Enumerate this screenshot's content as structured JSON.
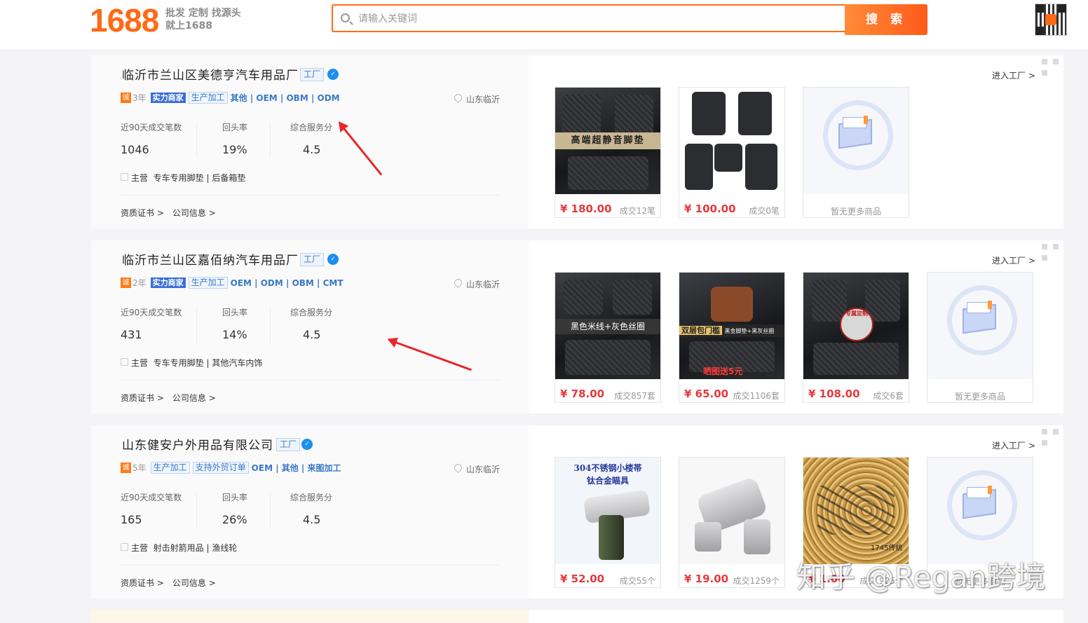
{
  "header": {
    "logo_number": "1688",
    "slogan_line1": "批发 定制 找源头",
    "slogan_line2": "就上1688",
    "search_placeholder": "请输入关键词",
    "search_button": "搜 索"
  },
  "common": {
    "enter_factory": "进入工厂 >",
    "cert_link": "资质证书 >",
    "company_link": "公司信息 >",
    "stat_labels": [
      "近90天成交笔数",
      "回头率",
      "综合服务分"
    ],
    "main_prefix": "主营",
    "factory_tag": "工厂",
    "cheng_icon": "诚",
    "sx_badge": "实力商家",
    "empty_text": "暂无更多商品"
  },
  "cards": [
    {
      "name": "临沂市兰山区美德亨汽车用品厂",
      "years": "3年",
      "tags_boxed": [
        "生产加工"
      ],
      "tags_plain": "其他 | OEM | OBM | ODM",
      "location": "山东临沂",
      "stats": [
        "1046",
        "19%",
        "4.5"
      ],
      "main_business": "专车专用脚垫 | 后备箱垫",
      "products": [
        {
          "price": "¥ 180.00",
          "sales": "成交12笔",
          "banner": "高端超静音脚垫"
        },
        {
          "price": "¥ 100.00",
          "sales": "成交0笔"
        }
      ]
    },
    {
      "name": "临沂市兰山区嘉佰纳汽车用品厂",
      "years": "2年",
      "tags_boxed": [
        "生产加工"
      ],
      "tags_plain": "OEM | ODM | OBM | CMT",
      "location": "山东临沂",
      "stats": [
        "431",
        "14%",
        "4.5"
      ],
      "main_business": "专车专用脚垫 | 其他汽车内饰",
      "products": [
        {
          "price": "¥ 78.00",
          "sales": "成交857套",
          "banner": "黑色米线+灰色丝圈"
        },
        {
          "price": "¥ 65.00",
          "sales": "成交1106套",
          "banner": "双层包门槛",
          "banner2": "黑金脚垫+黑灰丝圈",
          "banner3": "晒图送5元"
        },
        {
          "price": "¥ 108.00",
          "sales": "成交6套",
          "badge": "专属定制"
        }
      ]
    },
    {
      "name": "山东健安户外用品有限公司",
      "years": "5年",
      "tags_boxed": [
        "生产加工",
        "支持外贸订单"
      ],
      "tags_plain": "OEM | 其他 | 来图加工",
      "location": "山东临沂",
      "stats": [
        "165",
        "26%",
        "4.5"
      ],
      "main_business": "射击射箭用品 | 渔线轮",
      "products": [
        {
          "price": "¥ 52.00",
          "sales": "成交55个",
          "caption1": "304不锈钢小楼帯",
          "caption2": "钛合金瞄具"
        },
        {
          "price": "¥ 19.00",
          "sales": "成交1259个"
        },
        {
          "price": "¥ 1.00",
          "sales": "成交 925个",
          "caption3": "1745传统"
        }
      ]
    }
  ],
  "watermark": "知乎 @Regan跨境",
  "colors": {
    "brand_orange": "#ff6a16",
    "price_red": "#e4393c",
    "link_blue": "#3a78c8",
    "arrow_red": "#e8262c"
  }
}
